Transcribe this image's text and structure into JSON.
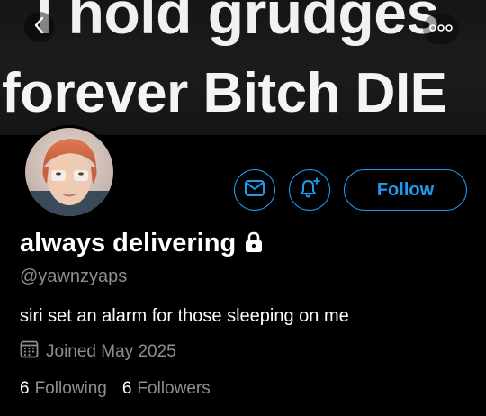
{
  "banner": {
    "line1": "I hold grudges",
    "line2": "forever Bitch DIE"
  },
  "profile": {
    "display_name": "always delivering",
    "handle": "@yawnzyaps",
    "bio": "siri set an alarm for those sleeping on me",
    "joined": "Joined May 2025",
    "following_count": "6",
    "following_label": "Following",
    "followers_count": "6",
    "followers_label": "Followers",
    "locked": true
  },
  "actions": {
    "follow_label": "Follow"
  },
  "icons": {
    "back": "chevron-left-icon",
    "more": "more-horizontal-icon",
    "message": "envelope-icon",
    "notify": "bell-plus-icon",
    "lock": "lock-icon",
    "calendar": "calendar-icon"
  },
  "colors": {
    "accent": "#1d9bf0",
    "background": "#000000",
    "secondary_text": "#8b8f94"
  }
}
